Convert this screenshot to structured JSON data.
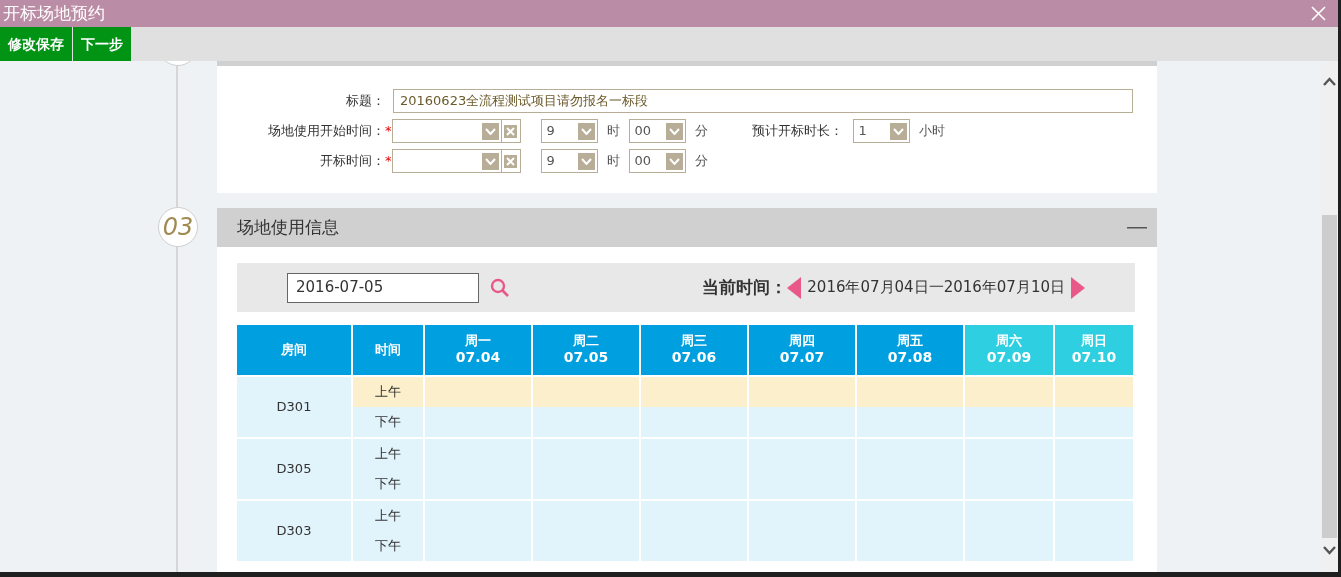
{
  "window": {
    "title": "开标场地预约"
  },
  "toolbar": [
    "修改保存",
    "下一步"
  ],
  "form": {
    "title_field": {
      "label": "标题：",
      "value": "20160623全流程测试项目请勿报名一标段"
    },
    "rows": [
      {
        "label": "场地使用开始时间：",
        "required_mark": "*",
        "date": "",
        "hour": "9",
        "hour_unit": "时",
        "minute": "00",
        "minute_unit": "分",
        "duration": {
          "label": "预计开标时长：",
          "value": "1",
          "unit": "小时"
        }
      },
      {
        "label": "开标时间：",
        "required_mark": "*",
        "date": "",
        "hour": "9",
        "hour_unit": "时",
        "minute": "00",
        "minute_unit": "分"
      }
    ]
  },
  "section": {
    "number": "03",
    "title": "场地使用信息",
    "search": {
      "value": "2016-07-05"
    },
    "current": {
      "label": "当前时间：",
      "range": "2016年07月04日一2016年07月10日"
    },
    "table": {
      "columns": [
        "房间",
        "时间"
      ],
      "days": [
        {
          "weekday": "周一",
          "date": "07.04",
          "weekend": false
        },
        {
          "weekday": "周二",
          "date": "07.05",
          "weekend": false
        },
        {
          "weekday": "周三",
          "date": "07.06",
          "weekend": false
        },
        {
          "weekday": "周四",
          "date": "07.07",
          "weekend": false
        },
        {
          "weekday": "周五",
          "date": "07.08",
          "weekend": false
        },
        {
          "weekday": "周六",
          "date": "07.09",
          "weekend": true
        },
        {
          "weekday": "周日",
          "date": "07.10",
          "weekend": true
        }
      ],
      "rooms": [
        {
          "name": "D301",
          "slots": [
            {
              "label": "上午",
              "highlighted": true
            },
            {
              "label": "下午",
              "highlighted": false
            }
          ]
        },
        {
          "name": "D305",
          "slots": [
            {
              "label": "上午",
              "highlighted": false
            },
            {
              "label": "下午",
              "highlighted": false
            }
          ]
        },
        {
          "name": "D303",
          "slots": [
            {
              "label": "上午",
              "highlighted": false
            },
            {
              "label": "下午",
              "highlighted": false
            }
          ]
        }
      ]
    }
  }
}
